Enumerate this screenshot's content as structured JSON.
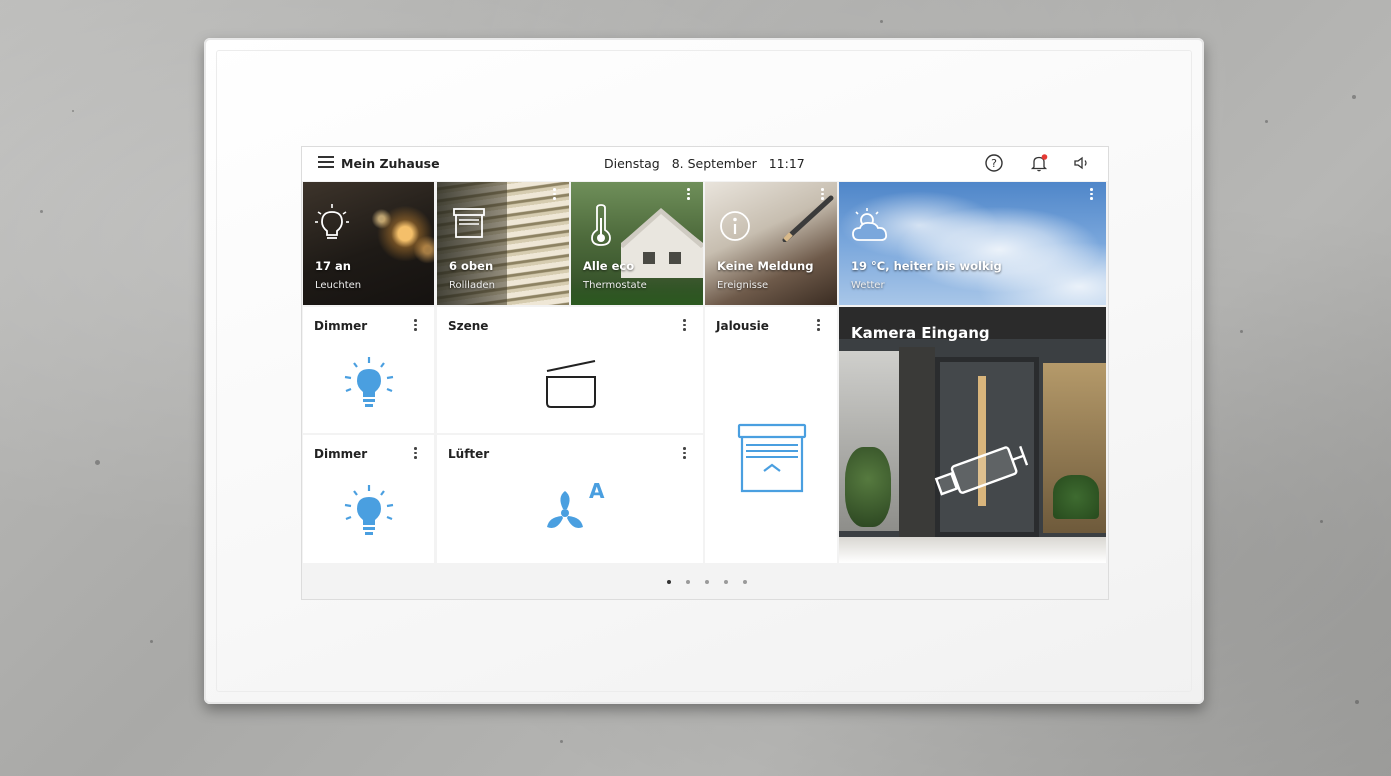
{
  "header": {
    "title": "Mein Zuhause",
    "weekday": "Dienstag",
    "date": "8. September",
    "time": "11:17"
  },
  "status_tiles": [
    {
      "value": "17 an",
      "label": "Leuchten",
      "icon": "lightbulb-icon"
    },
    {
      "value": "6 oben",
      "label": "Rollladen",
      "icon": "blind-icon"
    },
    {
      "value": "Alle eco",
      "label": "Thermostate",
      "icon": "thermometer-icon"
    },
    {
      "value": "Keine Meldung",
      "label": "Ereignisse",
      "icon": "info-icon"
    },
    {
      "value": "19 °C, heiter bis wolkig",
      "label": "Wetter",
      "icon": "partly-cloudy-icon"
    }
  ],
  "widgets": {
    "dimmer1": "Dimmer",
    "scene": "Szene",
    "blind": "Jalousie",
    "dimmer2": "Dimmer",
    "fan": "Lüfter",
    "fan_mode": "A",
    "camera": "Kamera Eingang"
  },
  "pager": {
    "pages": 5,
    "current": 1
  },
  "colors": {
    "accent": "#4a9fe0",
    "notification": "#e53935"
  }
}
